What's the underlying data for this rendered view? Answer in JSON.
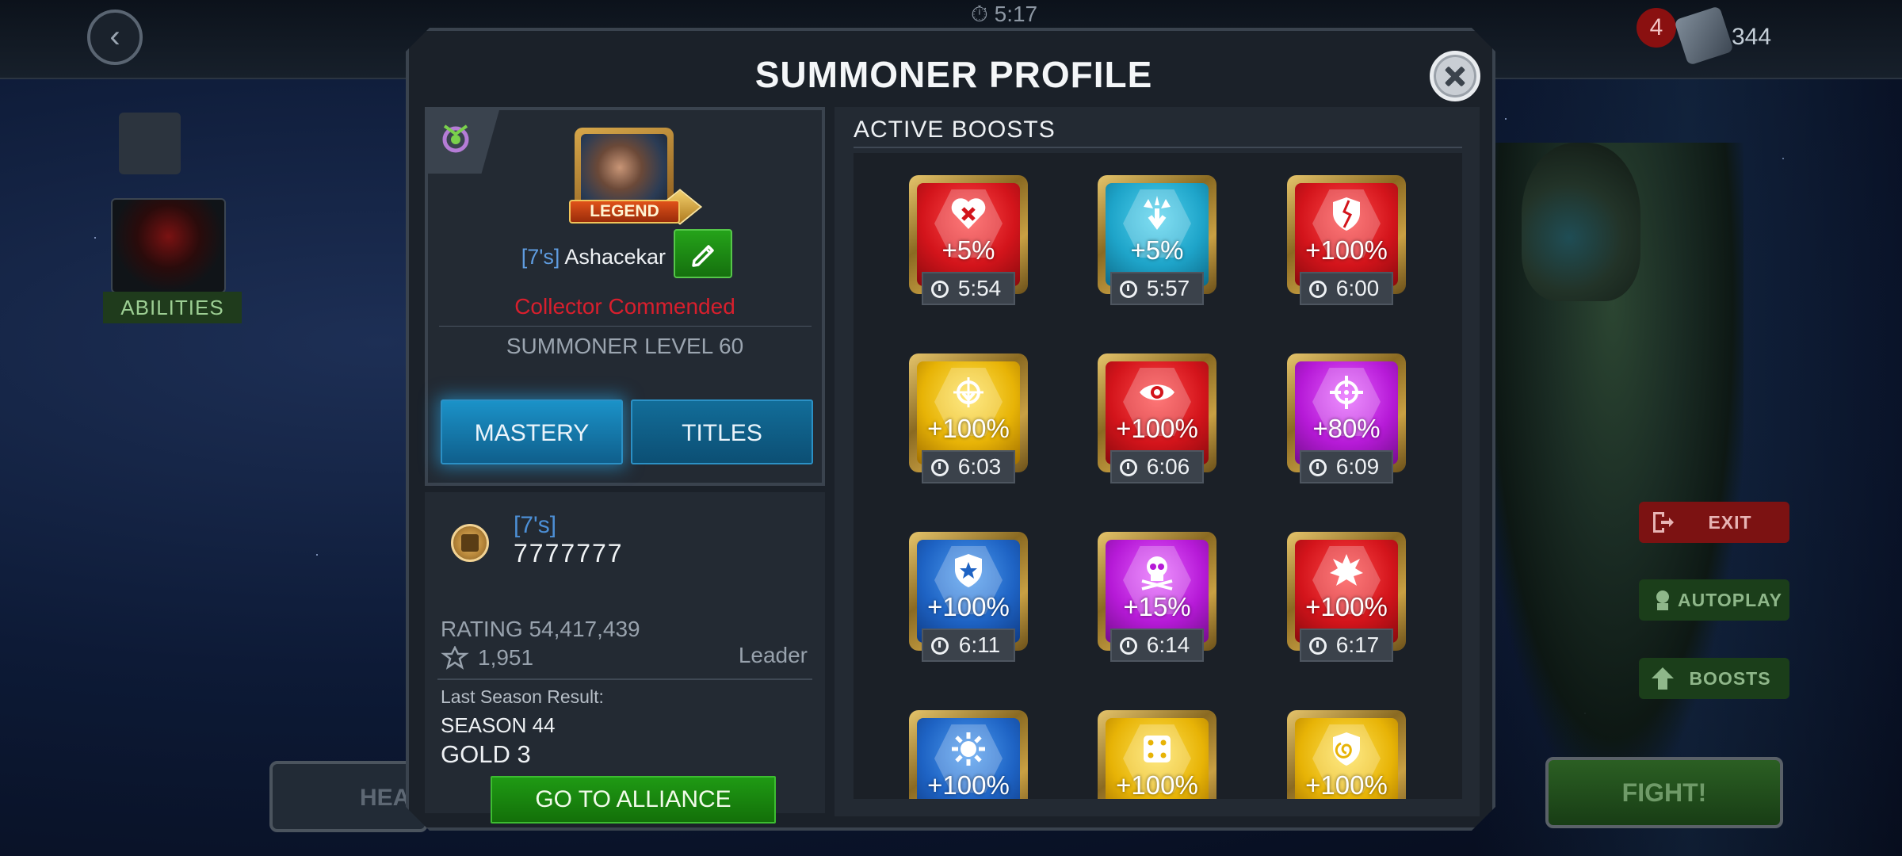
{
  "background": {
    "top_timer": "5:17",
    "notification_count": "4",
    "units": "344",
    "abilities_label": "ABILITIES",
    "exit_label": "EXIT",
    "autoplay_label": "AUTOPLAY",
    "boosts_label": "BOOSTS",
    "fight_label": "FIGHT!",
    "heal_label": "HEA"
  },
  "modal": {
    "title": "SUMMONER PROFILE"
  },
  "summoner": {
    "badge": "LEGEND",
    "alliance_tag": "[7's]",
    "name": "Ashacekar",
    "title": "Collector Commended",
    "level_text": "SUMMONER LEVEL 60",
    "tab_mastery": "MASTERY",
    "tab_titles": "TITLES"
  },
  "alliance": {
    "tag": "[7's]",
    "name": "7777777",
    "rating": "RATING 54,417,439",
    "trophies": "1,951",
    "role": "Leader",
    "last_season_label": "Last Season Result:",
    "season": "SEASON 44",
    "tier": "GOLD 3",
    "go_button": "GO TO ALLIANCE"
  },
  "boosts": {
    "title": "ACTIVE BOOSTS",
    "items": [
      {
        "value": "+5%",
        "timer": "5:54",
        "color": "#d3141b",
        "icon": "broken-heart-x-icon"
      },
      {
        "value": "+5%",
        "timer": "5:57",
        "color": "#1ea4c9",
        "icon": "burst-down-arrow-icon"
      },
      {
        "value": "+100%",
        "timer": "6:00",
        "color": "#d3141b",
        "icon": "cracked-shield-icon"
      },
      {
        "value": "+100%",
        "timer": "6:03",
        "color": "#e7b306",
        "icon": "target-down-arrow-icon"
      },
      {
        "value": "+100%",
        "timer": "6:06",
        "color": "#d3141b",
        "icon": "eye-icon"
      },
      {
        "value": "+80%",
        "timer": "6:09",
        "color": "#b61ad7",
        "icon": "crosshair-icon"
      },
      {
        "value": "+100%",
        "timer": "6:11",
        "color": "#1e63c4",
        "icon": "star-shield-icon"
      },
      {
        "value": "+15%",
        "timer": "6:14",
        "color": "#b61ad7",
        "icon": "skull-icon"
      },
      {
        "value": "+100%",
        "timer": "6:17",
        "color": "#d3141b",
        "icon": "flame-burst-icon"
      },
      {
        "value": "+100%",
        "timer": "",
        "color": "#1e63c4",
        "icon": "gear-burst-icon"
      },
      {
        "value": "+100%",
        "timer": "",
        "color": "#e7b306",
        "icon": "dice-icon"
      },
      {
        "value": "+100%",
        "timer": "",
        "color": "#e7b306",
        "icon": "spiral-shield-icon"
      }
    ]
  }
}
